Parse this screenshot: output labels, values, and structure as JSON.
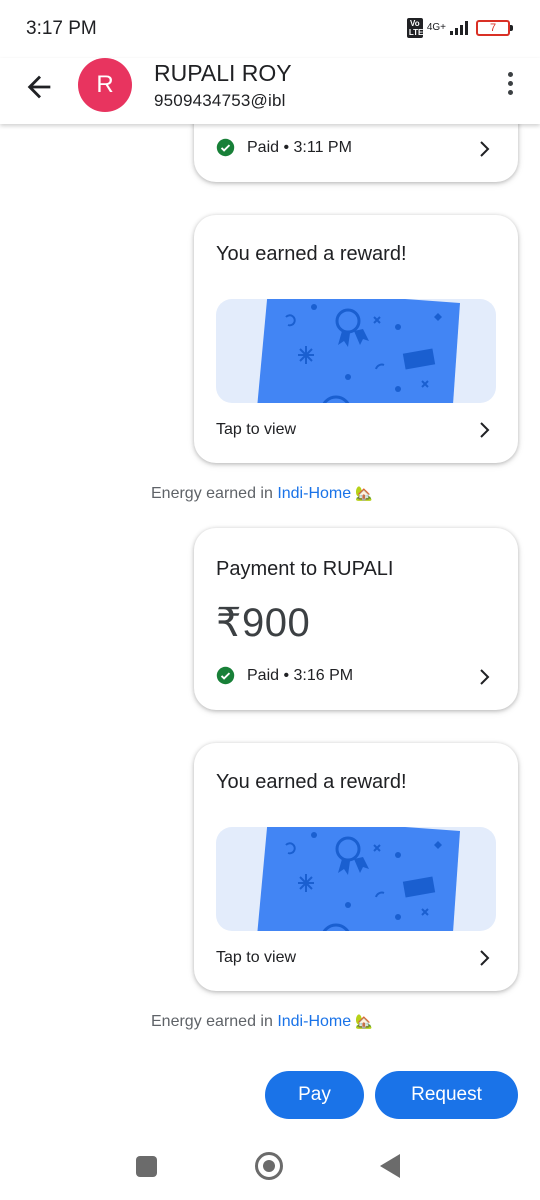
{
  "status_bar": {
    "time": "3:17 PM",
    "network": "4G+",
    "volte": "Vo LTE",
    "battery": "7"
  },
  "header": {
    "avatar_letter": "R",
    "name": "RUPALI ROY",
    "upi_id": "9509434753@ibl"
  },
  "messages": [
    {
      "type": "payment_partial",
      "status": "Paid • 3:11 PM"
    },
    {
      "type": "reward",
      "title": "You earned a reward!",
      "action": "Tap to view"
    },
    {
      "type": "energy",
      "prefix": "Energy earned in ",
      "link": "Indi-Home",
      "emoji": "🏡"
    },
    {
      "type": "payment",
      "title": "Payment to RUPALI",
      "amount": "₹900",
      "status": "Paid • 3:16 PM"
    },
    {
      "type": "reward",
      "title": "You earned a reward!",
      "action": "Tap to view"
    },
    {
      "type": "energy",
      "prefix": "Energy earned in ",
      "link": "Indi-Home",
      "emoji": "🏡"
    }
  ],
  "actions": {
    "pay_label": "Pay",
    "request_label": "Request"
  },
  "colors": {
    "accent": "#1a73e8",
    "avatar": "#e8345f",
    "paid_check": "#188038",
    "reward_card": "#4285f4",
    "reward_bg": "#e3ecfb"
  }
}
